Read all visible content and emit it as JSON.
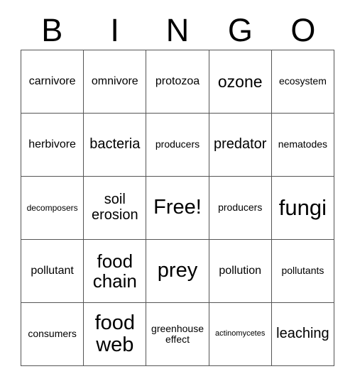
{
  "card": {
    "title": "BINGO",
    "header_letters": [
      "B",
      "I",
      "N",
      "G",
      "O"
    ],
    "grid_size": "5x5",
    "free_space": "Free!",
    "colors": {
      "background": "#ffffff",
      "text": "#000000",
      "border": "#555555"
    },
    "rows": [
      [
        {
          "label": "carnivore",
          "size": "m"
        },
        {
          "label": "omnivore",
          "size": "m"
        },
        {
          "label": "protozoa",
          "size": "m"
        },
        {
          "label": "ozone",
          "size": "xl"
        },
        {
          "label": "ecosystem",
          "size": "s"
        }
      ],
      [
        {
          "label": "herbivore",
          "size": "m"
        },
        {
          "label": "bacteria",
          "size": "l"
        },
        {
          "label": "producers",
          "size": "s"
        },
        {
          "label": "predator",
          "size": "l"
        },
        {
          "label": "nematodes",
          "size": "s"
        }
      ],
      [
        {
          "label": "decomposers",
          "size": "xs"
        },
        {
          "label": "soil erosion",
          "size": "l"
        },
        {
          "label": "Free!",
          "size": "3xl"
        },
        {
          "label": "producers",
          "size": "s"
        },
        {
          "label": "fungi",
          "size": "4xl"
        }
      ],
      [
        {
          "label": "pollutant",
          "size": "m"
        },
        {
          "label": "food chain",
          "size": "2xl"
        },
        {
          "label": "prey",
          "size": "3xl"
        },
        {
          "label": "pollution",
          "size": "m"
        },
        {
          "label": "pollutants",
          "size": "s"
        }
      ],
      [
        {
          "label": "consumers",
          "size": "s"
        },
        {
          "label": "food web",
          "size": "3xl"
        },
        {
          "label": "greenhouse effect",
          "size": "s"
        },
        {
          "label": "actinomycetes",
          "size": "xxs"
        },
        {
          "label": "leaching",
          "size": "l"
        }
      ]
    ]
  }
}
